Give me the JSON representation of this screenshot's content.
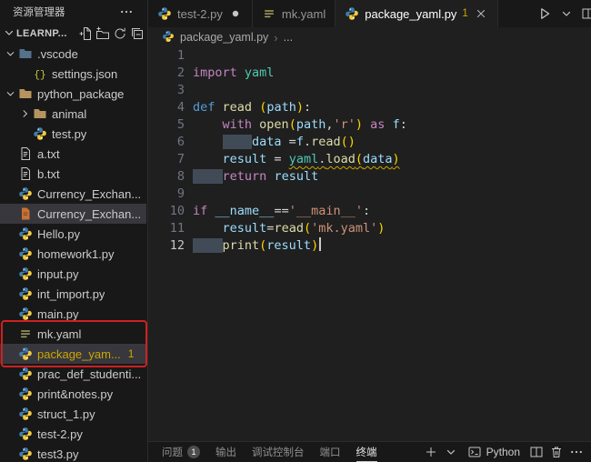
{
  "colors": {
    "warning": "#cca700",
    "annotation_red": "#cf2020",
    "selection_bg": "#37373d",
    "python_blue": "#3f7cac",
    "python_yellow": "#f5cb3f"
  },
  "sidebar": {
    "title": "资源管理器",
    "header_icons": [
      "more"
    ],
    "section_label": "LEARNP...",
    "section_icons": [
      "new-file",
      "new-folder",
      "refresh",
      "collapse-all"
    ],
    "tree": [
      {
        "label": ".vscode",
        "icon": "folder-blue",
        "depth": 0,
        "chevron": "down"
      },
      {
        "label": "settings.json",
        "icon": "json",
        "depth": 1
      },
      {
        "label": "python_package",
        "icon": "folder-tan",
        "depth": 0,
        "chevron": "down"
      },
      {
        "label": "animal",
        "icon": "folder-tan",
        "depth": 1,
        "chevron": "right"
      },
      {
        "label": "test.py",
        "icon": "python",
        "depth": 1
      },
      {
        "label": "a.txt",
        "icon": "txt",
        "depth": 0
      },
      {
        "label": "b.txt",
        "icon": "txt",
        "depth": 0
      },
      {
        "label": "Currency_Exchan...",
        "icon": "python",
        "depth": 0
      },
      {
        "label": "Currency_Exchan...",
        "icon": "orange-file",
        "depth": 0,
        "selected": true
      },
      {
        "label": "Hello.py",
        "icon": "python",
        "depth": 0
      },
      {
        "label": "homework1.py",
        "icon": "python",
        "depth": 0
      },
      {
        "label": "input.py",
        "icon": "python",
        "depth": 0
      },
      {
        "label": "int_import.py",
        "icon": "python",
        "depth": 0
      },
      {
        "label": "main.py",
        "icon": "python",
        "depth": 0
      },
      {
        "label": "mk.yaml",
        "icon": "yaml",
        "depth": 0
      },
      {
        "label": "package_yam...",
        "icon": "python",
        "depth": 0,
        "selected": true,
        "badge": "1",
        "warning": true
      },
      {
        "label": "prac_def_studenti...",
        "icon": "python",
        "depth": 0
      },
      {
        "label": "print&notes.py",
        "icon": "python",
        "depth": 0
      },
      {
        "label": "struct_1.py",
        "icon": "python",
        "depth": 0
      },
      {
        "label": "test-2.py",
        "icon": "python",
        "depth": 0
      },
      {
        "label": "test3.py",
        "icon": "python",
        "depth": 0
      }
    ]
  },
  "tabs": [
    {
      "label": "test-2.py",
      "icon": "python",
      "modified": true
    },
    {
      "label": "mk.yaml",
      "icon": "yaml"
    },
    {
      "label": "package_yaml.py",
      "icon": "python",
      "badge": "1",
      "active": true,
      "closable": true
    }
  ],
  "editor_actions": [
    "play",
    "chevron-down",
    "split"
  ],
  "breadcrumb": {
    "file": "package_yaml.py",
    "separator": "›",
    "more": "..."
  },
  "editor": {
    "lines": [
      {
        "n": "1",
        "t": []
      },
      {
        "n": "2",
        "t": [
          [
            "c",
            "import"
          ],
          [
            "p",
            " "
          ],
          [
            "m",
            "yaml"
          ]
        ]
      },
      {
        "n": "3",
        "t": []
      },
      {
        "n": "4",
        "t": [
          [
            "k",
            "def"
          ],
          [
            "p",
            " "
          ],
          [
            "f",
            "read"
          ],
          [
            "p",
            " "
          ],
          [
            "b",
            "("
          ],
          [
            "v",
            "path"
          ],
          [
            "b",
            ")"
          ],
          [
            "p",
            ":"
          ]
        ]
      },
      {
        "n": "5",
        "t": [
          [
            "w",
            "    "
          ],
          [
            "c",
            "with"
          ],
          [
            "p",
            " "
          ],
          [
            "f",
            "open"
          ],
          [
            "b",
            "("
          ],
          [
            "v",
            "path"
          ],
          [
            "p",
            ","
          ],
          [
            "s",
            "'r'"
          ],
          [
            "b",
            ")"
          ],
          [
            "p",
            " "
          ],
          [
            "c",
            "as"
          ],
          [
            "p",
            " "
          ],
          [
            "v",
            "f"
          ],
          [
            "p",
            ":"
          ]
        ]
      },
      {
        "n": "6",
        "t": [
          [
            "w",
            "    "
          ],
          [
            "h",
            "    "
          ],
          [
            "v",
            "data"
          ],
          [
            "p",
            " ="
          ],
          [
            "v",
            "f"
          ],
          [
            "p",
            "."
          ],
          [
            "f",
            "read"
          ],
          [
            "b",
            "()"
          ]
        ]
      },
      {
        "n": "7",
        "t": [
          [
            "w",
            "    "
          ],
          [
            "v",
            "result"
          ],
          [
            "p",
            " = "
          ],
          [
            "m",
            "yaml",
            "u"
          ],
          [
            "p",
            ".",
            "u"
          ],
          [
            "f",
            "load",
            "u"
          ],
          [
            "b",
            "(",
            "u"
          ],
          [
            "v",
            "data",
            "u"
          ],
          [
            "b",
            ")",
            "u"
          ]
        ]
      },
      {
        "n": "8",
        "t": [
          [
            "h",
            "    "
          ],
          [
            "c",
            "return"
          ],
          [
            "p",
            " "
          ],
          [
            "v",
            "result"
          ]
        ]
      },
      {
        "n": "9",
        "t": []
      },
      {
        "n": "10",
        "t": [
          [
            "c",
            "if"
          ],
          [
            "p",
            " "
          ],
          [
            "v",
            "__name__"
          ],
          [
            "p",
            "=="
          ],
          [
            "s",
            "'__main__'"
          ],
          [
            "p",
            ":"
          ]
        ]
      },
      {
        "n": "11",
        "t": [
          [
            "w",
            "    "
          ],
          [
            "v",
            "result"
          ],
          [
            "p",
            "="
          ],
          [
            "f",
            "read"
          ],
          [
            "b",
            "("
          ],
          [
            "s",
            "'mk.yaml'"
          ],
          [
            "b",
            ")"
          ]
        ]
      },
      {
        "n": "12",
        "t": [
          [
            "h",
            "    "
          ],
          [
            "f",
            "print"
          ],
          [
            "b",
            "("
          ],
          [
            "v",
            "result"
          ],
          [
            "b",
            ")"
          ]
        ],
        "cursor": true,
        "active": true
      }
    ]
  },
  "panel": {
    "tabs": [
      {
        "label": "问题",
        "badge": "1"
      },
      {
        "label": "输出"
      },
      {
        "label": "调试控制台"
      },
      {
        "label": "端口"
      },
      {
        "label": "终端",
        "active": true
      }
    ],
    "new_terminal_icons": [
      "plus",
      "chevron-down"
    ],
    "profile_label": "Python",
    "profile_icon": "terminal",
    "right_icons": [
      "split",
      "trash",
      "more"
    ]
  }
}
